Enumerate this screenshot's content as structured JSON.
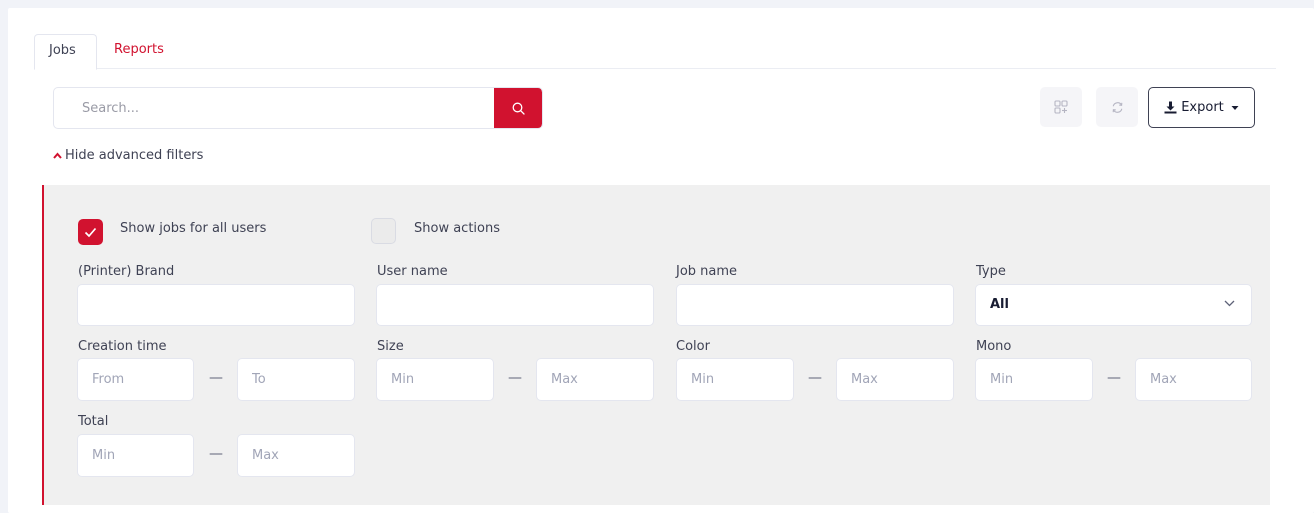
{
  "tabs": [
    {
      "label": "Jobs",
      "active": true
    },
    {
      "label": "Reports",
      "active": false
    }
  ],
  "search": {
    "placeholder": "Search..."
  },
  "toolbar": {
    "export_label": "Export"
  },
  "filters_toggle": {
    "label": "Hide advanced filters"
  },
  "checkboxes": [
    {
      "label": "Show jobs for all users",
      "checked": true
    },
    {
      "label": "Show actions",
      "checked": false
    }
  ],
  "fields": {
    "brand": {
      "label": "(Printer) Brand",
      "value": ""
    },
    "user_name": {
      "label": "User name",
      "value": ""
    },
    "job_name": {
      "label": "Job name",
      "value": ""
    },
    "type": {
      "label": "Type",
      "value": "All"
    }
  },
  "ranges": {
    "creation_time": {
      "label": "Creation time",
      "from_placeholder": "From",
      "to_placeholder": "To",
      "separator": "—"
    },
    "size": {
      "label": "Size",
      "min_placeholder": "Min",
      "max_placeholder": "Max",
      "separator": "—"
    },
    "color": {
      "label": "Color",
      "min_placeholder": "Min",
      "max_placeholder": "Max",
      "separator": "—"
    },
    "mono": {
      "label": "Mono",
      "min_placeholder": "Min",
      "max_placeholder": "Max",
      "separator": "—"
    },
    "total": {
      "label": "Total",
      "min_placeholder": "Min",
      "max_placeholder": "Max",
      "separator": "—"
    }
  },
  "colors": {
    "accent": "#d1122f",
    "panel_bg": "#f0f0f0"
  },
  "icons": [
    "search-icon",
    "grid-icon",
    "refresh-icon",
    "download-icon",
    "caret-down-icon",
    "caret-up-icon",
    "checkmark-icon",
    "chevron-down-icon"
  ]
}
